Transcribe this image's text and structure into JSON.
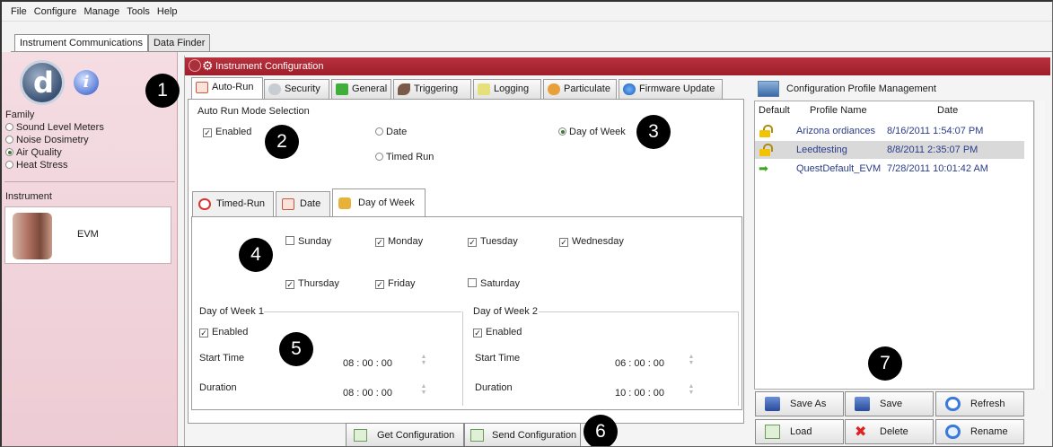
{
  "menu": [
    "File",
    "Configure",
    "Manage",
    "Tools",
    "Help"
  ],
  "top_tabs": [
    "Instrument Communications",
    "Data Finder"
  ],
  "sidebar": {
    "family_label": "Family",
    "families": [
      {
        "label": "Sound Level Meters",
        "selected": false
      },
      {
        "label": "Noise Dosimetry",
        "selected": false
      },
      {
        "label": "Air Quality",
        "selected": true
      },
      {
        "label": "Heat Stress",
        "selected": false
      }
    ],
    "instrument_label": "Instrument",
    "instrument_name": "EVM"
  },
  "window_title": "Instrument Configuration",
  "config_tabs": [
    "Auto-Run",
    "Security",
    "General",
    "Triggering",
    "Logging",
    "Particulate",
    "Firmware Update"
  ],
  "autorun": {
    "section_title": "Auto Run Mode Selection",
    "enabled_label": "Enabled",
    "enabled": true,
    "modes": [
      {
        "label": "Date",
        "selected": false
      },
      {
        "label": "Timed Run",
        "selected": false
      },
      {
        "label": "Day of Week",
        "selected": true
      }
    ]
  },
  "inner_tabs": [
    "Timed-Run",
    "Date",
    "Day of Week"
  ],
  "days": [
    {
      "label": "Sunday",
      "checked": false
    },
    {
      "label": "Monday",
      "checked": true
    },
    {
      "label": "Tuesday",
      "checked": true
    },
    {
      "label": "Wednesday",
      "checked": true
    },
    {
      "label": "Thursday",
      "checked": true
    },
    {
      "label": "Friday",
      "checked": true
    },
    {
      "label": "Saturday",
      "checked": false
    }
  ],
  "dow1": {
    "title": "Day of Week 1",
    "enabled_label": "Enabled",
    "start_label": "Start Time",
    "start": "08 : 00 : 00",
    "duration_label": "Duration",
    "duration": "08 : 00 : 00"
  },
  "dow2": {
    "title": "Day of Week 2",
    "enabled_label": "Enabled",
    "start_label": "Start Time",
    "start": "06 : 00 : 00",
    "duration_label": "Duration",
    "duration": "10 : 00 : 00"
  },
  "bottom_buttons": {
    "get": "Get Configuration",
    "send": "Send Configuration"
  },
  "profiles": {
    "title": "Configuration Profile Management",
    "columns": [
      "Default",
      "Profile Name",
      "Date"
    ],
    "rows": [
      {
        "name": "Arizona ordiances",
        "date": "8/16/2011 1:54:07 PM",
        "icon": "lock-icon"
      },
      {
        "name": "Leedtesting",
        "date": "8/8/2011 2:35:07 PM",
        "icon": "lock-icon"
      },
      {
        "name": "QuestDefault_EVM",
        "date": "7/28/2011 10:01:42 AM",
        "icon": "arrow-right-icon"
      }
    ],
    "buttons": [
      "Save As",
      "Save",
      "Refresh",
      "Load",
      "Delete",
      "Rename"
    ]
  },
  "callouts": [
    "1",
    "2",
    "3",
    "4",
    "5",
    "6",
    "7"
  ],
  "colors": {
    "title_bar": "#a8232f",
    "sidebar": "#f0d2da",
    "accent_green": "#3ca41a"
  }
}
